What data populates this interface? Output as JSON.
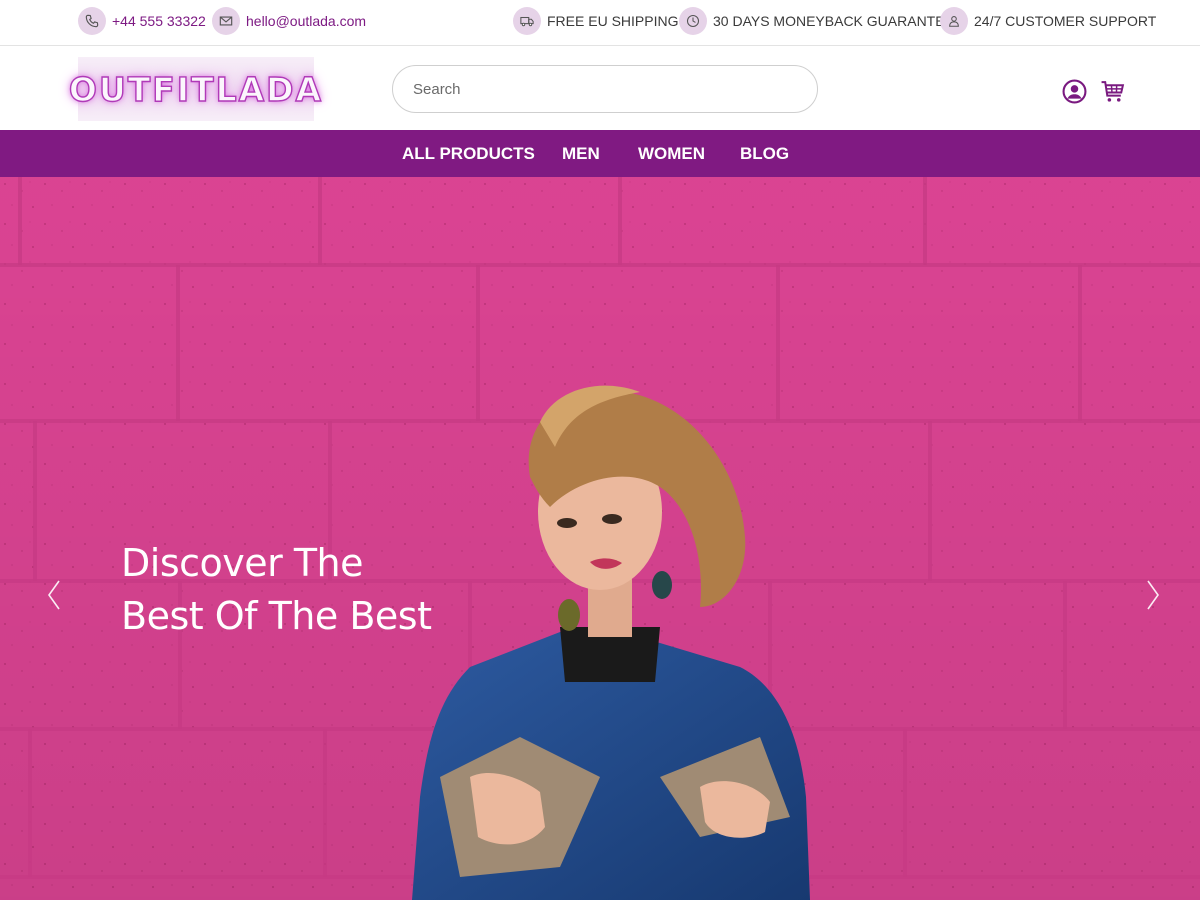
{
  "topbar": {
    "phone": "+44 555 33322",
    "email": "hello@outlada.com",
    "shipping": "FREE EU SHIPPING",
    "guarantee": "30 DAYS MONEYBACK GUARANTEE",
    "support": "24/7 CUSTOMER SUPPORT"
  },
  "header": {
    "logo_text": "OUTFITLADA",
    "search_placeholder": "Search",
    "search_value": ""
  },
  "nav": {
    "items": [
      "ALL PRODUCTS",
      "MEN",
      "WOMEN",
      "BLOG"
    ]
  },
  "hero": {
    "title_line1": "Discover The",
    "title_line2": "Best Of The Best"
  },
  "icons": {
    "phone": "phone-icon",
    "email": "envelope-icon",
    "shipping": "truck-icon",
    "guarantee": "clock-icon",
    "support": "person-icon",
    "account": "user-circle-icon",
    "cart": "cart-icon",
    "prev": "chevron-left-icon",
    "next": "chevron-right-icon"
  },
  "colors": {
    "brand_purple": "#801a82",
    "icon_circle": "#e6d3e8",
    "hero_wall": "#e6479a",
    "contact_text": "#7d1a83"
  }
}
